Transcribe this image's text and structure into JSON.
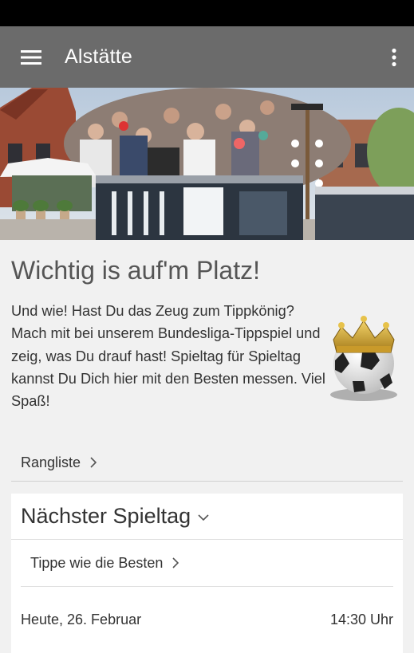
{
  "app_bar": {
    "title": "Alstätte",
    "menu_icon": "hamburger-menu-icon",
    "overflow_icon": "more-vertical-icon",
    "background": "#6b6b6b"
  },
  "hero": {
    "image": "village square with crowd, maypole and buildings"
  },
  "content": {
    "headline": "Wichtig is auf'm Platz!",
    "intro": "Und wie! Hast Du das Zeug zum Tippkönig? Mach mit bei unserem Bundesliga-Tippspiel und zeig, was Du drauf hast! Spieltag für Spieltag kannst Du Dich hier mit den Besten messen. Viel Spaß!",
    "trophy_icon": "soccer-ball-crown-icon"
  },
  "ranking_link": {
    "label": "Rangliste"
  },
  "next_matchday": {
    "title": "Nächster Spieltag",
    "tip_link": "Tippe wie die Besten",
    "date": "Heute, 26. Februar",
    "time": "14:30 Uhr"
  }
}
